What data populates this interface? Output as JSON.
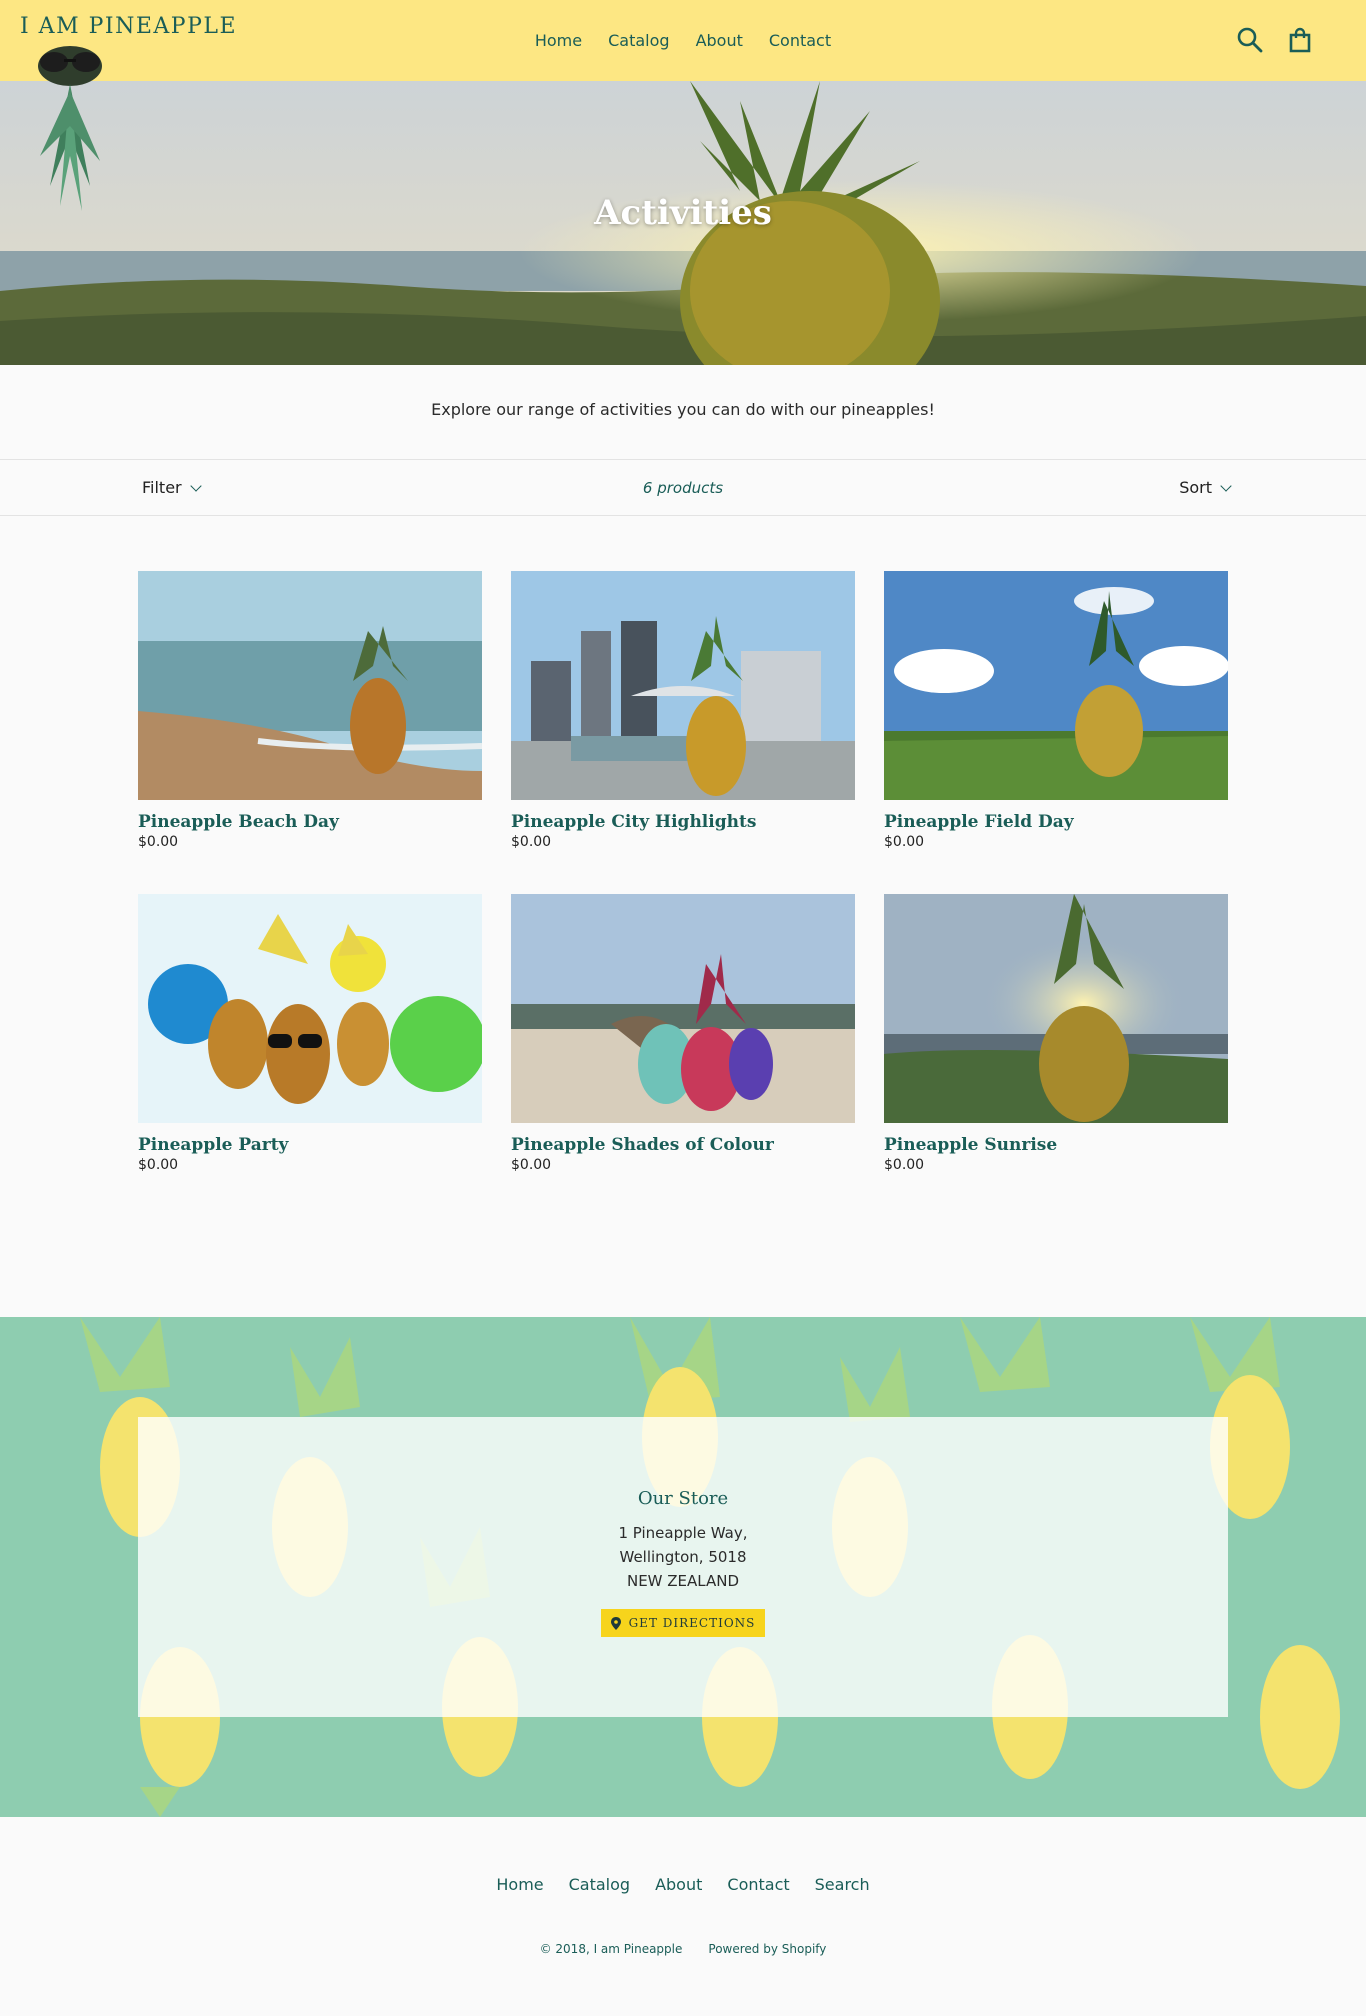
{
  "header": {
    "logo": "I AM PINEAPPLE",
    "nav": [
      "Home",
      "Catalog",
      "About",
      "Contact"
    ],
    "icons": [
      "search-icon",
      "cart-icon"
    ],
    "bg_color": "#fde783"
  },
  "hero": {
    "title": "Activities"
  },
  "collection": {
    "description": "Explore our range of activities you can do with our pineapples!",
    "filter_label": "Filter",
    "count": "6 products",
    "sort_label": "Sort"
  },
  "products": [
    {
      "title": "Pineapple Beach Day",
      "price": "$0.00"
    },
    {
      "title": "Pineapple City Highlights",
      "price": "$0.00"
    },
    {
      "title": "Pineapple Field Day",
      "price": "$0.00"
    },
    {
      "title": "Pineapple Party",
      "price": "$0.00"
    },
    {
      "title": "Pineapple Shades of Colour",
      "price": "$0.00"
    },
    {
      "title": "Pineapple Sunrise",
      "price": "$0.00"
    }
  ],
  "store": {
    "title": "Our Store",
    "address_line1": "1 Pineapple Way,",
    "address_line2": "Wellington, 5018",
    "address_line3": "NEW ZEALAND",
    "button": "GET DIRECTIONS",
    "bg_color": "#8ecdb0",
    "button_color": "#f7d41c"
  },
  "footer": {
    "nav": [
      "Home",
      "Catalog",
      "About",
      "Contact",
      "Search"
    ],
    "copyright": "© 2018, I am Pineapple",
    "powered": "Powered by Shopify"
  },
  "colors": {
    "accent": "#1a5d57"
  }
}
